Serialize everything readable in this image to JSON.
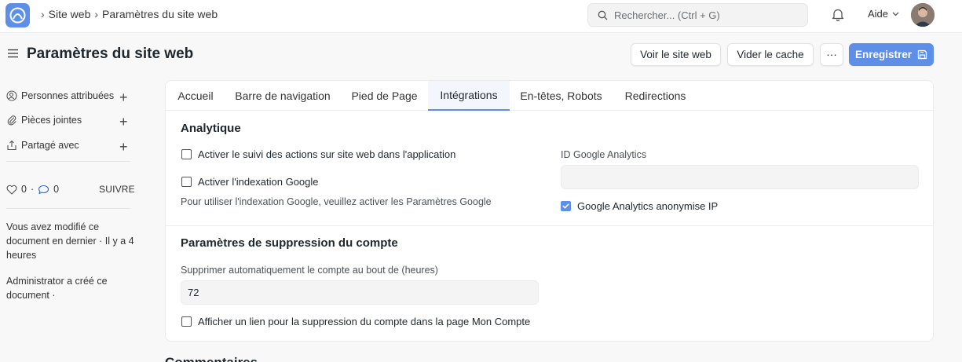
{
  "navbar": {
    "breadcrumbs": [
      "Site web",
      "Paramètres du site web"
    ],
    "search_placeholder": "Rechercher... (Ctrl + G)",
    "help_label": "Aide"
  },
  "header": {
    "title": "Paramètres du site web",
    "view_site_label": "Voir le site web",
    "clear_cache_label": "Vider le cache",
    "more_label": "···",
    "save_label": "Enregistrer"
  },
  "sidebar": {
    "items": [
      {
        "label": "Personnes attribuées",
        "icon": "user-assign-icon"
      },
      {
        "label": "Pièces jointes",
        "icon": "paperclip-icon"
      },
      {
        "label": "Partagé avec",
        "icon": "share-icon"
      }
    ],
    "likes_count": "0",
    "comments_count": "0",
    "follow_label": "SUIVRE",
    "activity_1": "Vous avez modifié ce document en dernier · Il y a 4 heures",
    "activity_2": "Administrator a créé ce document ·"
  },
  "tabs": [
    "Accueil",
    "Barre de navigation",
    "Pied de Page",
    "Intégrations",
    "En-têtes, Robots",
    "Redirections"
  ],
  "analytics": {
    "title": "Analytique",
    "track_actions_label": "Activer le suivi des actions sur site web dans l'application",
    "track_actions_checked": false,
    "google_indexing_label": "Activer l'indexation Google",
    "google_indexing_checked": false,
    "google_indexing_hint": "Pour utiliser l'indexation Google, veuillez activer les Paramètres Google",
    "ga_id_label": "ID Google Analytics",
    "ga_id_value": "",
    "ga_anonymize_label": "Google Analytics anonymise IP",
    "ga_anonymize_checked": true
  },
  "account_deletion": {
    "title": "Paramètres de suppression du compte",
    "auto_delete_label": "Supprimer automatiquement le compte au bout de (heures)",
    "auto_delete_value": "72",
    "show_link_label": "Afficher un lien pour la suppression du compte dans la page Mon Compte",
    "show_link_checked": false
  },
  "next_section_title": "Commentaires",
  "colors": {
    "primary": "#5e8fe8",
    "background": "#f8f8f8",
    "text": "#1f272e"
  }
}
